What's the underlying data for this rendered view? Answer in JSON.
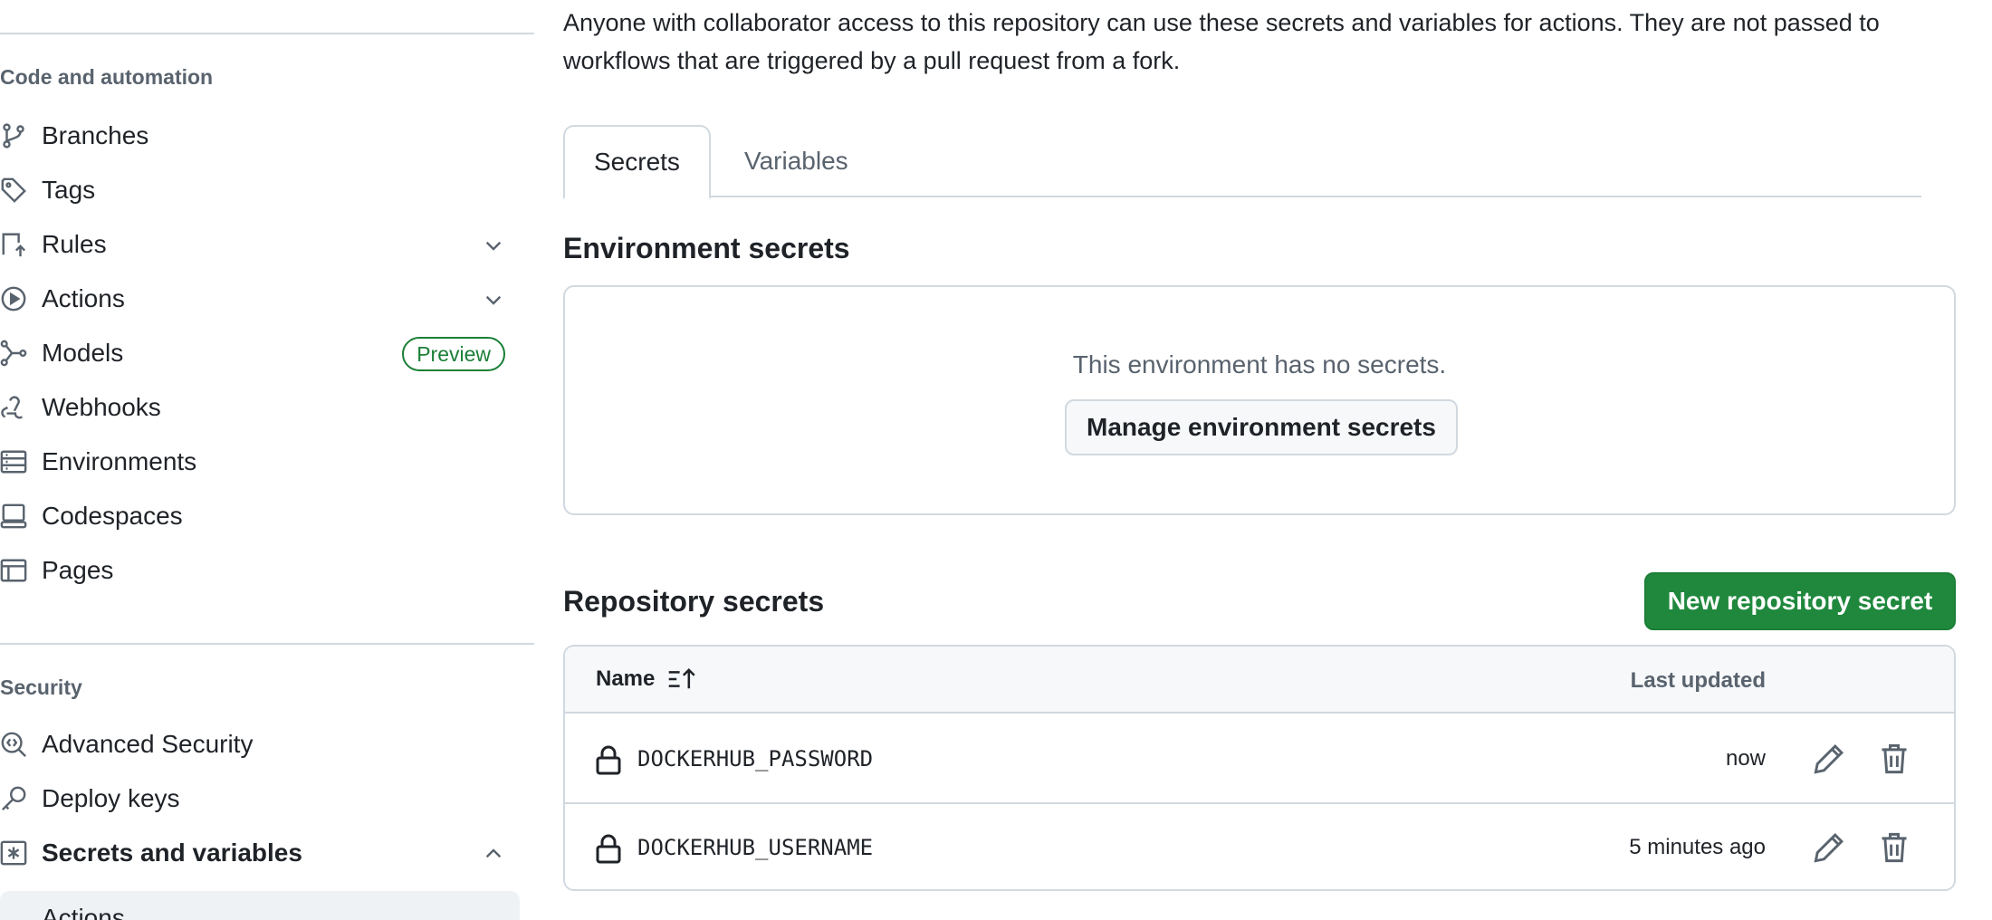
{
  "sidebar": {
    "sections": {
      "code_automation": "Code and automation",
      "security": "Security"
    },
    "items": [
      {
        "label": "Branches"
      },
      {
        "label": "Tags"
      },
      {
        "label": "Rules"
      },
      {
        "label": "Actions"
      },
      {
        "label": "Models",
        "badge": "Preview"
      },
      {
        "label": "Webhooks"
      },
      {
        "label": "Environments"
      },
      {
        "label": "Codespaces"
      },
      {
        "label": "Pages"
      },
      {
        "label": "Advanced Security"
      },
      {
        "label": "Deploy keys"
      },
      {
        "label": "Secrets and variables"
      },
      {
        "label": "Actions"
      }
    ]
  },
  "main": {
    "description": "Anyone with collaborator access to this repository can use these secrets and variables for actions. They are not passed to workflows that are triggered by a pull request from a fork.",
    "tabs": [
      {
        "label": "Secrets",
        "selected": true
      },
      {
        "label": "Variables",
        "selected": false
      }
    ],
    "environment": {
      "heading": "Environment secrets",
      "empty_text": "This environment has no secrets.",
      "manage_button": "Manage environment secrets"
    },
    "repository": {
      "heading": "Repository secrets",
      "new_button": "New repository secret",
      "columns": {
        "name": "Name",
        "updated": "Last updated"
      },
      "rows": [
        {
          "name": "DOCKERHUB_PASSWORD",
          "updated": "now"
        },
        {
          "name": "DOCKERHUB_USERNAME",
          "updated": "5 minutes ago"
        }
      ]
    }
  },
  "colors": {
    "accent_green": "#1f883d",
    "badge_green": "#1a7f37",
    "border": "#d1d9e0",
    "muted_text": "#59636e"
  }
}
